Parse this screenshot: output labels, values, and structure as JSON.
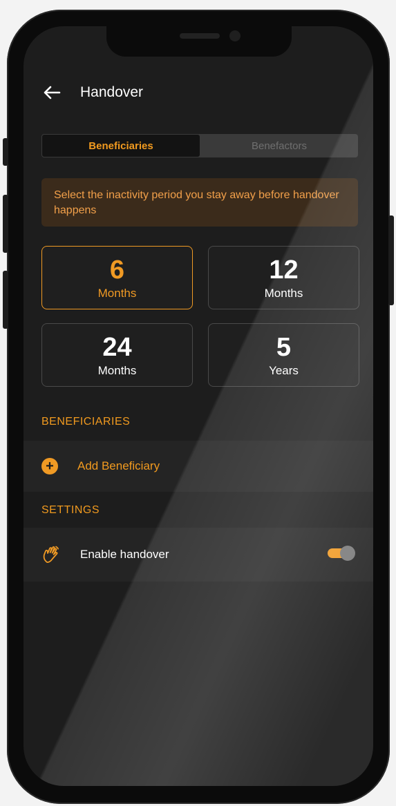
{
  "header": {
    "title": "Handover",
    "back_icon": "arrow-left-icon"
  },
  "tabs": [
    {
      "label": "Beneficiaries",
      "active": true
    },
    {
      "label": "Benefactors",
      "active": false
    }
  ],
  "info": {
    "text": "Select the inactivity period you stay away before handover happens"
  },
  "periods": [
    {
      "value": "6",
      "unit": "Months",
      "selected": true
    },
    {
      "value": "12",
      "unit": "Months",
      "selected": false
    },
    {
      "value": "24",
      "unit": "Months",
      "selected": false
    },
    {
      "value": "5",
      "unit": "Years",
      "selected": false
    }
  ],
  "beneficiaries_section": {
    "label": "BENEFICIARIES",
    "add_label": "Add Beneficiary",
    "add_icon": "plus-circle-icon"
  },
  "settings_section": {
    "label": "SETTINGS",
    "enable_label": "Enable handover",
    "enable_icon": "hand-icon",
    "enabled": true
  },
  "colors": {
    "accent": "#f09a24",
    "background": "#1d1d1d",
    "info_bg": "#3b2b1b"
  }
}
